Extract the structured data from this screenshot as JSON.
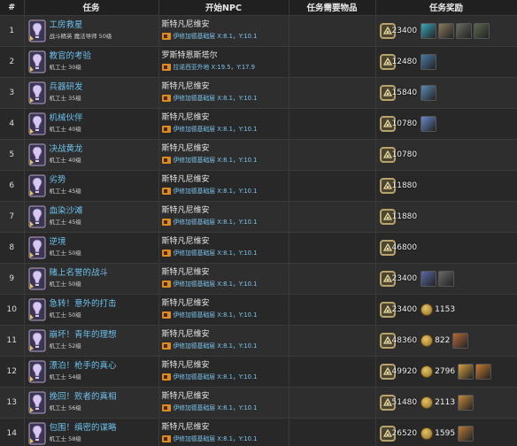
{
  "headers": [
    "#",
    "任务",
    "开始NPC",
    "任务需要物品",
    "任务奖励"
  ],
  "rows": [
    {
      "num": "1",
      "name": "工房救星",
      "sub": "战斗精英 魔法导师 50级",
      "npc": "斯特凡尼维安",
      "loc": "伊修加德基础层 X:8.1，Y:10.1",
      "gil": "23400",
      "coins": [],
      "items": [
        {
          "name": "item-icon",
          "color": "#3aa7b8"
        },
        {
          "name": "item-icon",
          "color": "#8a7a5a"
        },
        {
          "name": "item-icon",
          "color": "#6a6a60"
        },
        {
          "name": "item-icon",
          "color": "#5a6a50"
        }
      ]
    },
    {
      "num": "2",
      "name": "教官的考验",
      "sub": "机工士 30级",
      "npc": "罗斯特恩斯塔尔",
      "loc": "拉诺西亚外地 X:19.5，Y:17.9",
      "gil": "12480",
      "coins": [],
      "items": [
        {
          "name": "item-icon",
          "color": "#4a7aa8"
        }
      ]
    },
    {
      "num": "3",
      "name": "兵器研发",
      "sub": "机工士 35级",
      "npc": "斯特凡尼维安",
      "loc": "伊修加德基础层 X:8.1，Y:10.1",
      "gil": "15840",
      "coins": [],
      "items": [
        {
          "name": "item-icon",
          "color": "#5a8ab8"
        }
      ]
    },
    {
      "num": "4",
      "name": "机械伙伴",
      "sub": "机工士 40级",
      "npc": "斯特凡尼维安",
      "loc": "伊修加德基础层 X:8.1，Y:10.1",
      "gil": "10780",
      "coins": [],
      "items": [
        {
          "name": "item-icon",
          "color": "#6a8ac8"
        }
      ]
    },
    {
      "num": "5",
      "name": "决战黄龙",
      "sub": "机工士 40级",
      "npc": "斯特凡尼维安",
      "loc": "伊修加德基础层 X:8.1，Y:10.1",
      "gil": "10780",
      "coins": [],
      "items": []
    },
    {
      "num": "6",
      "name": "劣势",
      "sub": "机工士 45级",
      "npc": "斯特凡尼维安",
      "loc": "伊修加德基础层 X:8.1，Y:10.1",
      "gil": "11880",
      "coins": [],
      "items": []
    },
    {
      "num": "7",
      "name": "血染沙滩",
      "sub": "机工士 45级",
      "npc": "斯特凡尼维安",
      "loc": "伊修加德基础层 X:8.1，Y:10.1",
      "gil": "11880",
      "coins": [],
      "items": []
    },
    {
      "num": "8",
      "name": "逆境",
      "sub": "机工士 50级",
      "npc": "斯特凡尼维安",
      "loc": "伊修加德基础层 X:8.1，Y:10.1",
      "gil": "46800",
      "coins": [],
      "items": []
    },
    {
      "num": "9",
      "name": "赌上名誉的战斗",
      "sub": "机工士 50级",
      "npc": "斯特凡尼维安",
      "loc": "伊修加德基础层 X:8.1，Y:10.1",
      "gil": "23400",
      "coins": [],
      "items": [
        {
          "name": "item-icon",
          "color": "#5a6aa8"
        },
        {
          "name": "item-icon",
          "color": "#6a6a6a"
        }
      ]
    },
    {
      "num": "10",
      "name": "急转！意外的打击",
      "sub": "机工士 50级",
      "npc": "斯特凡尼维安",
      "loc": "伊修加德基础层 X:8.1，Y:10.1",
      "gil": "23400",
      "coins": [
        "1153"
      ],
      "items": []
    },
    {
      "num": "11",
      "name": "崩坏！青年的理想",
      "sub": "机工士 52级",
      "npc": "斯特凡尼维安",
      "loc": "伊修加德基础层 X:8.1，Y:10.1",
      "gil": "48360",
      "coins": [
        "822"
      ],
      "items": [
        {
          "name": "item-icon",
          "color": "#b86a3a"
        }
      ]
    },
    {
      "num": "12",
      "name": "漂泊！枪手的真心",
      "sub": "机工士 54级",
      "npc": "斯特凡尼维安",
      "loc": "伊修加德基础层 X:8.1，Y:10.1",
      "gil": "49920",
      "coins": [
        "2796"
      ],
      "items": [
        {
          "name": "item-icon",
          "color": "#d8a040"
        },
        {
          "name": "item-icon",
          "color": "#c87a30"
        }
      ]
    },
    {
      "num": "13",
      "name": "挽回！败者的真相",
      "sub": "机工士 56级",
      "npc": "斯特凡尼维安",
      "loc": "伊修加德基础层 X:8.1，Y:10.1",
      "gil": "51480",
      "coins": [
        "2113"
      ],
      "items": [
        {
          "name": "item-icon",
          "color": "#c88a40"
        }
      ]
    },
    {
      "num": "14",
      "name": "包围！缜密的谋略",
      "sub": "机工士 58级",
      "npc": "斯特凡尼维安",
      "loc": "伊修加德基础层 X:8.1，Y:10.1",
      "gil": "26520",
      "coins": [
        "1595"
      ],
      "items": [
        {
          "name": "item-icon",
          "color": "#b87a3a"
        }
      ]
    }
  ]
}
